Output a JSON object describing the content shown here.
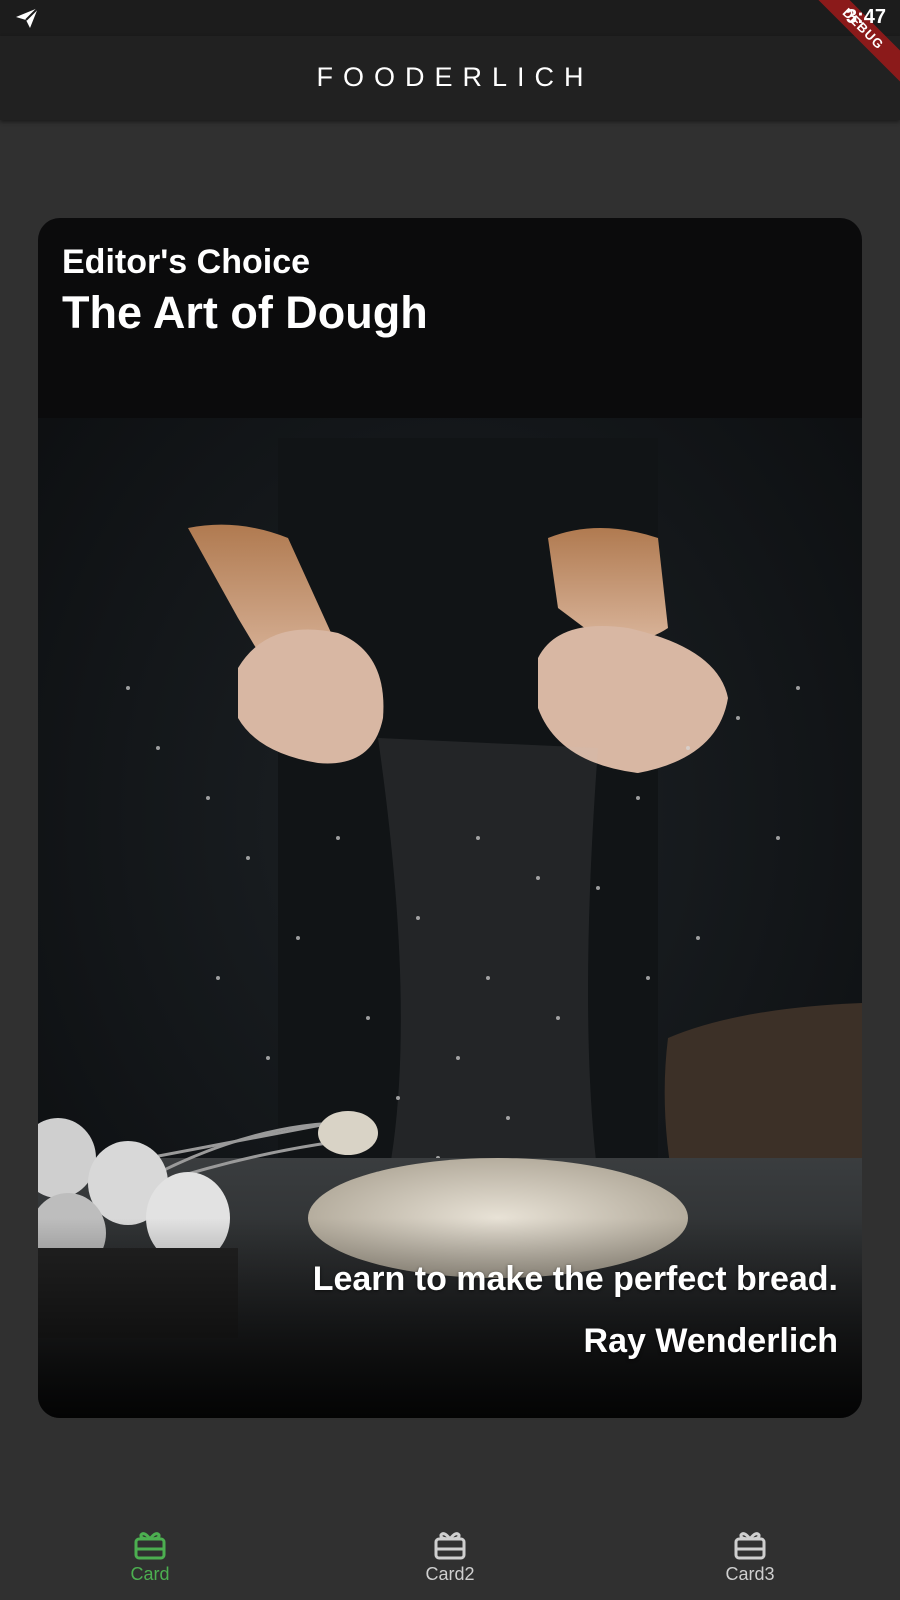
{
  "status_bar": {
    "time": "3:47",
    "debug_label": "DEBUG",
    "left_icon": "send-icon"
  },
  "app_bar": {
    "title": "FOODERLICH"
  },
  "card": {
    "category": "Editor's Choice",
    "title": "The Art of Dough",
    "description": "Learn to make the perfect bread.",
    "author": "Ray Wenderlich",
    "image": "flour-dusting-photo"
  },
  "bottom_nav": {
    "items": [
      {
        "label": "Card",
        "icon": "card-giftcard-icon",
        "active": true
      },
      {
        "label": "Card2",
        "icon": "card-giftcard-icon",
        "active": false
      },
      {
        "label": "Card3",
        "icon": "card-giftcard-icon",
        "active": false
      }
    ],
    "active_color": "#4caf50",
    "inactive_color": "#cfcfcf"
  },
  "colors": {
    "background": "#303030",
    "app_bar": "#212121",
    "card_background": "#0b0b0c",
    "text": "#ffffff"
  }
}
